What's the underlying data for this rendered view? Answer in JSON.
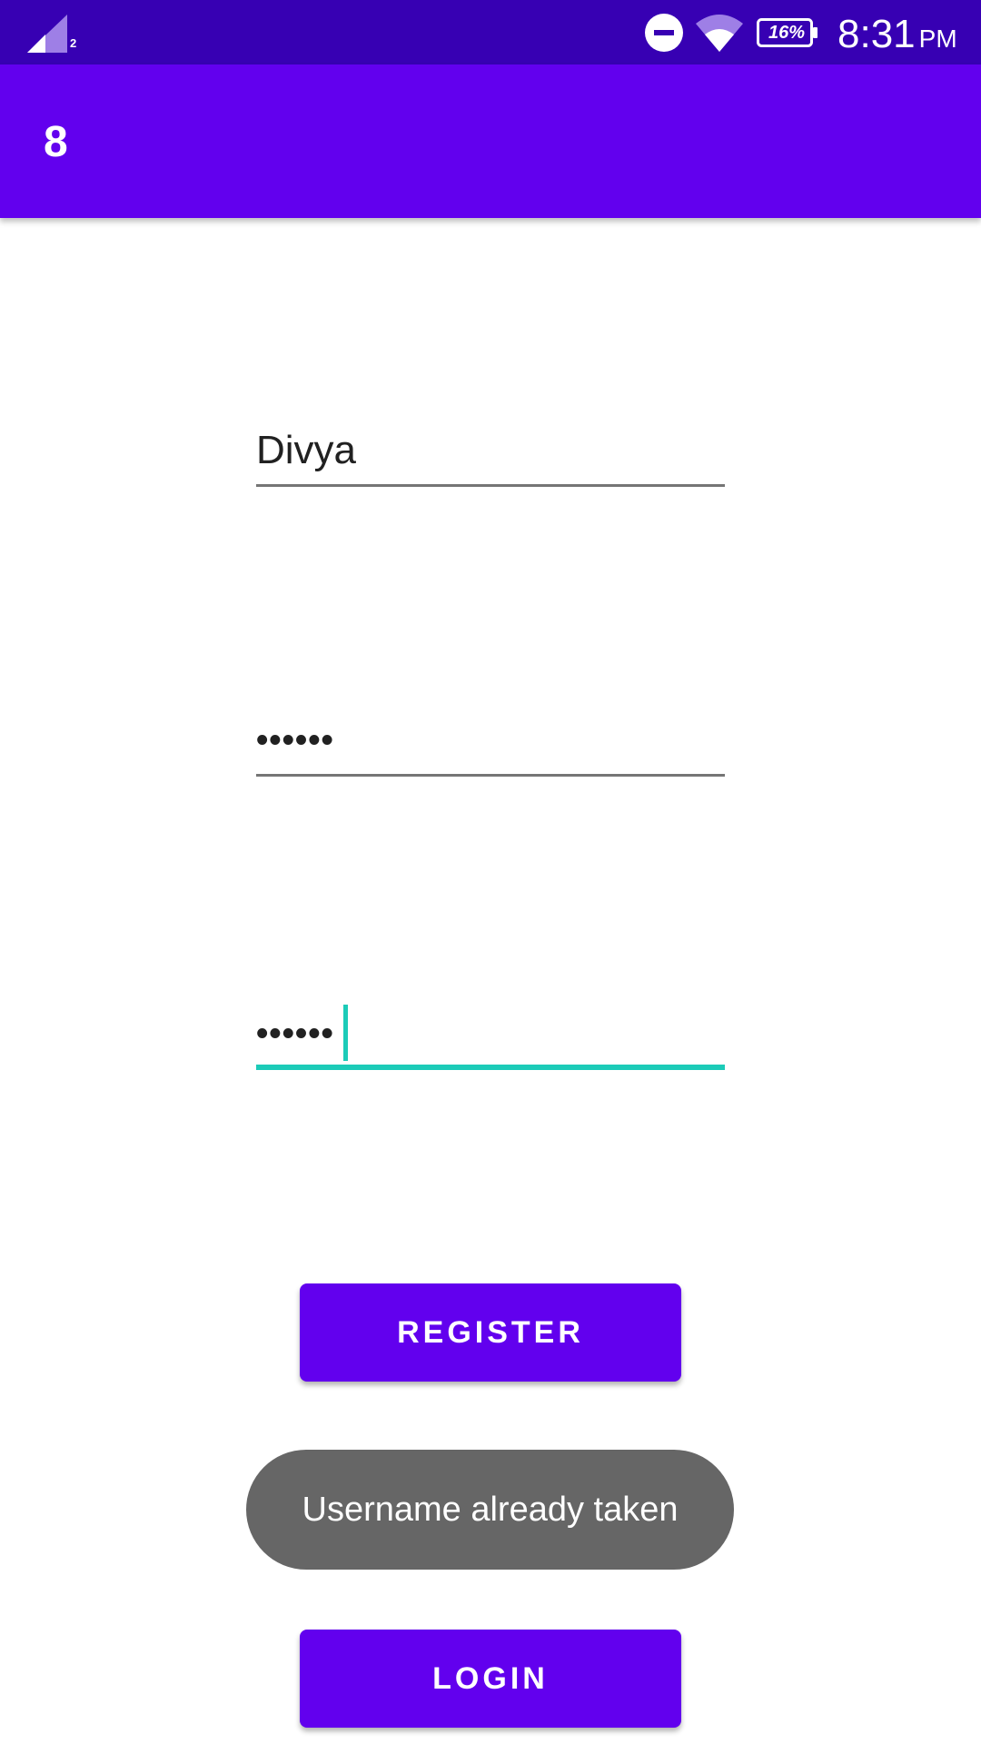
{
  "status_bar": {
    "sim_label": "2",
    "battery": "16%",
    "time": "8:31",
    "ampm": "PM",
    "icons": [
      "signal-icon",
      "do-not-disturb-icon",
      "wifi-icon",
      "battery-icon"
    ]
  },
  "app_bar": {
    "title": "8"
  },
  "form": {
    "username_value": "Divya",
    "password_value": "••••••",
    "confirm_password_value": "••••••"
  },
  "buttons": {
    "register_label": "REGISTER",
    "login_label": "LOGIN"
  },
  "toast": {
    "message": "Username already taken"
  },
  "colors": {
    "status_bar": "#3700b3",
    "primary": "#6200ee",
    "accent": "#1ccbb8",
    "toast_bg": "#666666"
  }
}
